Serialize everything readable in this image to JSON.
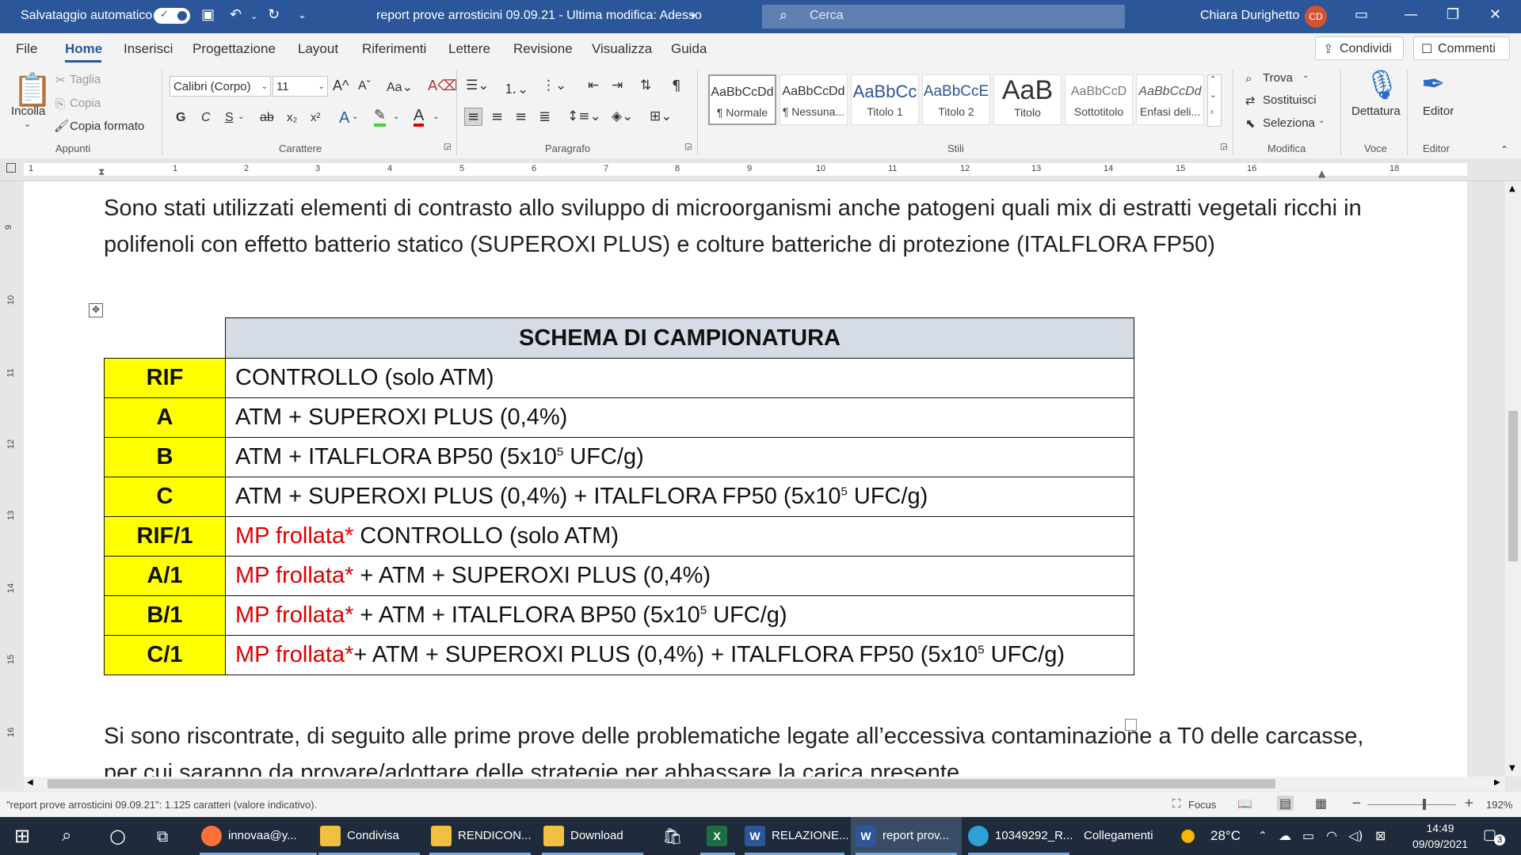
{
  "titlebar": {
    "autosave_label": "Salvataggio automatico",
    "document_title": "report prove arrosticini 09.09.21  -  Ultima modifica: Adesso",
    "search_placeholder": "Cerca",
    "user_name": "Chiara Durighetto",
    "user_initials": "CD"
  },
  "menu": {
    "items": [
      "File",
      "Home",
      "Inserisci",
      "Progettazione",
      "Layout",
      "Riferimenti",
      "Lettere",
      "Revisione",
      "Visualizza",
      "Guida"
    ],
    "share_label": "Condividi",
    "comments_label": "Commenti"
  },
  "ribbon": {
    "clipboard": {
      "paste": "Incolla",
      "cut": "Taglia",
      "copy": "Copia",
      "format_painter": "Copia formato",
      "group": "Appunti"
    },
    "font": {
      "name": "Calibri (Corpo)",
      "size": "11",
      "group": "Carattere"
    },
    "paragraph": {
      "group": "Paragrafo"
    },
    "styles": {
      "group": "Stili",
      "items": [
        {
          "preview": "AaBbCcDd",
          "name": "¶ Normale"
        },
        {
          "preview": "AaBbCcDd",
          "name": "¶ Nessuna..."
        },
        {
          "preview": "AaBbCc",
          "name": "Titolo 1"
        },
        {
          "preview": "AaBbCcE",
          "name": "Titolo 2"
        },
        {
          "preview": "AaB",
          "name": "Titolo"
        },
        {
          "preview": "AaBbCcD",
          "name": "Sottotitolo"
        },
        {
          "preview": "AaBbCcDd",
          "name": "Enfasi deli..."
        }
      ]
    },
    "editing": {
      "find": "Trova",
      "replace": "Sostituisci",
      "select": "Seleziona",
      "group": "Modifica"
    },
    "voice": {
      "dictate": "Dettatura",
      "group": "Voce"
    },
    "editor": {
      "label": "Editor",
      "group": "Editor"
    }
  },
  "ruler": {
    "h_numbers": [
      "1",
      "1",
      "2",
      "3",
      "4",
      "5",
      "6",
      "7",
      "8",
      "9",
      "10",
      "11",
      "12",
      "13",
      "14",
      "15",
      "16",
      "18"
    ],
    "v_numbers": [
      "9",
      "10",
      "11",
      "12",
      "13",
      "14",
      "15",
      "16"
    ]
  },
  "document": {
    "para1": "Sono stati utilizzati elementi di contrasto allo sviluppo di microorganismi anche patogeni quali mix di estratti vegetali ricchi in polifenoli con effetto batterio statico (SUPEROXI PLUS) e colture batteriche di protezione (ITALFLORA FP50)",
    "table_header": "SCHEMA DI CAMPIONATURA",
    "rows": [
      {
        "code": "RIF",
        "prefix": "",
        "text": "CONTROLLO (solo ATM)",
        "sup": "",
        "suffix": ""
      },
      {
        "code": "A",
        "prefix": "",
        "text": "ATM + SUPEROXI PLUS (0,4%)",
        "sup": "",
        "suffix": ""
      },
      {
        "code": "B",
        "prefix": "",
        "text": "ATM + ITALFLORA BP50 (5x10",
        "sup": "5",
        "suffix": " UFC/g)"
      },
      {
        "code": "C",
        "prefix": "",
        "text": "ATM + SUPEROXI PLUS (0,4%) + ITALFLORA FP50 (5x10",
        "sup": "5",
        "suffix": " UFC/g)"
      },
      {
        "code": "RIF/1",
        "prefix": "MP frollata*",
        "text": " CONTROLLO (solo ATM)",
        "sup": "",
        "suffix": ""
      },
      {
        "code": "A/1",
        "prefix": "MP frollata*",
        "text": " + ATM + SUPEROXI PLUS (0,4%)",
        "sup": "",
        "suffix": ""
      },
      {
        "code": "B/1",
        "prefix": "MP frollata*",
        "text": " + ATM + ITALFLORA BP50 (5x10",
        "sup": "5",
        "suffix": " UFC/g)"
      },
      {
        "code": "C/1",
        "prefix": "MP frollata*",
        "text": "+ ATM + SUPEROXI PLUS (0,4%) + ITALFLORA FP50 (5x10",
        "sup": "5",
        "suffix": " UFC/g)"
      }
    ],
    "para2": "Si sono riscontrate, di seguito alle prime prove delle problematiche legate all’eccessiva contaminazione a T0 delle carcasse, per cui saranno da provare/adottare delle strategie per abbassare la carica presente"
  },
  "statusbar": {
    "word_count": "\"report prove arrosticini 09.09.21\": 1.125 caratteri (valore indicativo).",
    "focus": "Focus",
    "zoom": "192%"
  },
  "taskbar": {
    "items": [
      {
        "label": "innovaa@y...",
        "icon": "firefox-icon",
        "color": "#ff7139"
      },
      {
        "label": "Condivisa",
        "icon": "folder-icon",
        "color": "#f0c040"
      },
      {
        "label": "RENDICON...",
        "icon": "folder-icon",
        "color": "#f0c040"
      },
      {
        "label": "Download",
        "icon": "folder-download-icon",
        "color": "#f0c040"
      },
      {
        "label": "",
        "icon": "store-icon",
        "color": "#ffffff"
      },
      {
        "label": "",
        "icon": "excel-icon",
        "color": "#1d6f42"
      },
      {
        "label": "RELAZIONE...",
        "icon": "word-icon",
        "color": "#2b579a"
      },
      {
        "label": "report prov...",
        "icon": "word-icon",
        "color": "#2b579a"
      },
      {
        "label": "10349292_R...",
        "icon": "edge-icon",
        "color": "#2ea0d8"
      }
    ],
    "links_label": "Collegamenti",
    "temperature": "28°C",
    "time": "14:49",
    "date": "09/09/2021",
    "notifications": "3"
  }
}
